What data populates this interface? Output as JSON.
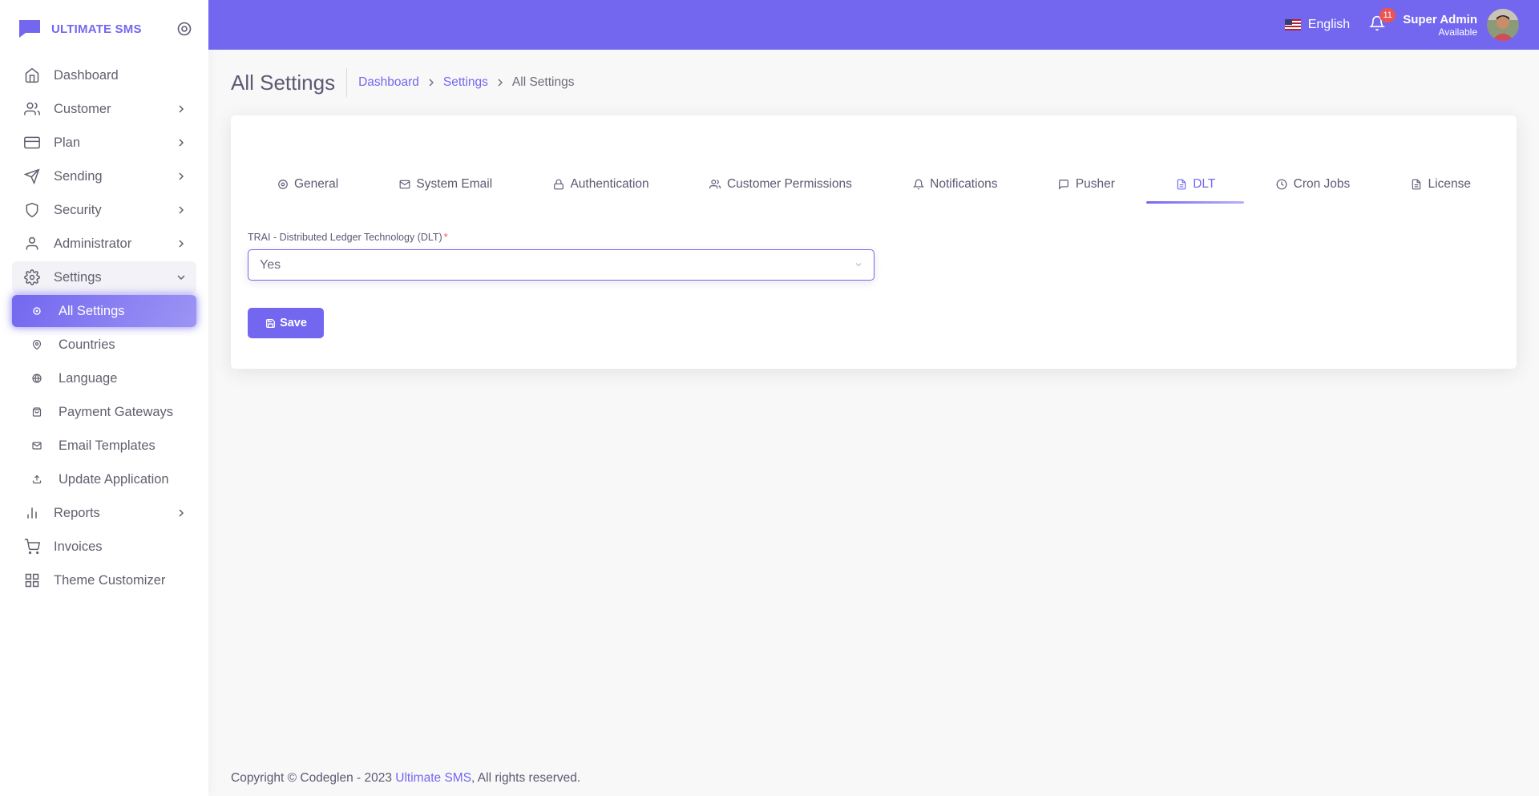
{
  "brand": {
    "name": "ULTIMATE SMS"
  },
  "sidebar": {
    "items": [
      {
        "label": "Dashboard",
        "icon": "home-icon"
      },
      {
        "label": "Customer",
        "icon": "users-icon"
      },
      {
        "label": "Plan",
        "icon": "credit-card-icon"
      },
      {
        "label": "Sending",
        "icon": "send-icon"
      },
      {
        "label": "Security",
        "icon": "shield-icon"
      },
      {
        "label": "Administrator",
        "icon": "user-icon"
      },
      {
        "label": "Settings",
        "icon": "settings-icon"
      }
    ],
    "settings_sub": [
      {
        "label": "All Settings",
        "icon": "circle-icon"
      },
      {
        "label": "Countries",
        "icon": "map-pin-icon"
      },
      {
        "label": "Language",
        "icon": "globe-icon"
      },
      {
        "label": "Payment Gateways",
        "icon": "shopping-bag-icon"
      },
      {
        "label": "Email Templates",
        "icon": "mail-icon"
      },
      {
        "label": "Update Application",
        "icon": "upload-icon"
      }
    ],
    "items_bottom": [
      {
        "label": "Reports",
        "icon": "bar-chart-icon"
      },
      {
        "label": "Invoices",
        "icon": "shopping-cart-icon"
      },
      {
        "label": "Theme Customizer",
        "icon": "grid-icon"
      }
    ]
  },
  "header": {
    "language": "English",
    "notification_count": "11",
    "user_name": "Super Admin",
    "user_status": "Available"
  },
  "page": {
    "title": "All Settings",
    "breadcrumb": [
      "Dashboard",
      "Settings",
      "All Settings"
    ]
  },
  "tabs": [
    {
      "label": "General",
      "icon": "settings-icon"
    },
    {
      "label": "System Email",
      "icon": "mail-icon"
    },
    {
      "label": "Authentication",
      "icon": "lock-icon"
    },
    {
      "label": "Customer Permissions",
      "icon": "users-icon"
    },
    {
      "label": "Notifications",
      "icon": "bell-icon"
    },
    {
      "label": "Pusher",
      "icon": "message-square-icon"
    },
    {
      "label": "DLT",
      "icon": "file-text-icon"
    },
    {
      "label": "Cron Jobs",
      "icon": "clock-icon"
    },
    {
      "label": "License",
      "icon": "file-text-icon"
    }
  ],
  "active_tab": "DLT",
  "form": {
    "dlt_label": "TRAI - Distributed Ledger Technology (DLT)",
    "required_mark": "*",
    "dlt_value": "Yes",
    "save_label": "Save"
  },
  "footer": {
    "prefix": "Copyright © Codeglen - 2023 ",
    "link": "Ultimate SMS",
    "suffix": ", All rights reserved."
  },
  "colors": {
    "primary": "#7367f0",
    "danger": "#ea5455",
    "text": "#6e6b7b"
  }
}
